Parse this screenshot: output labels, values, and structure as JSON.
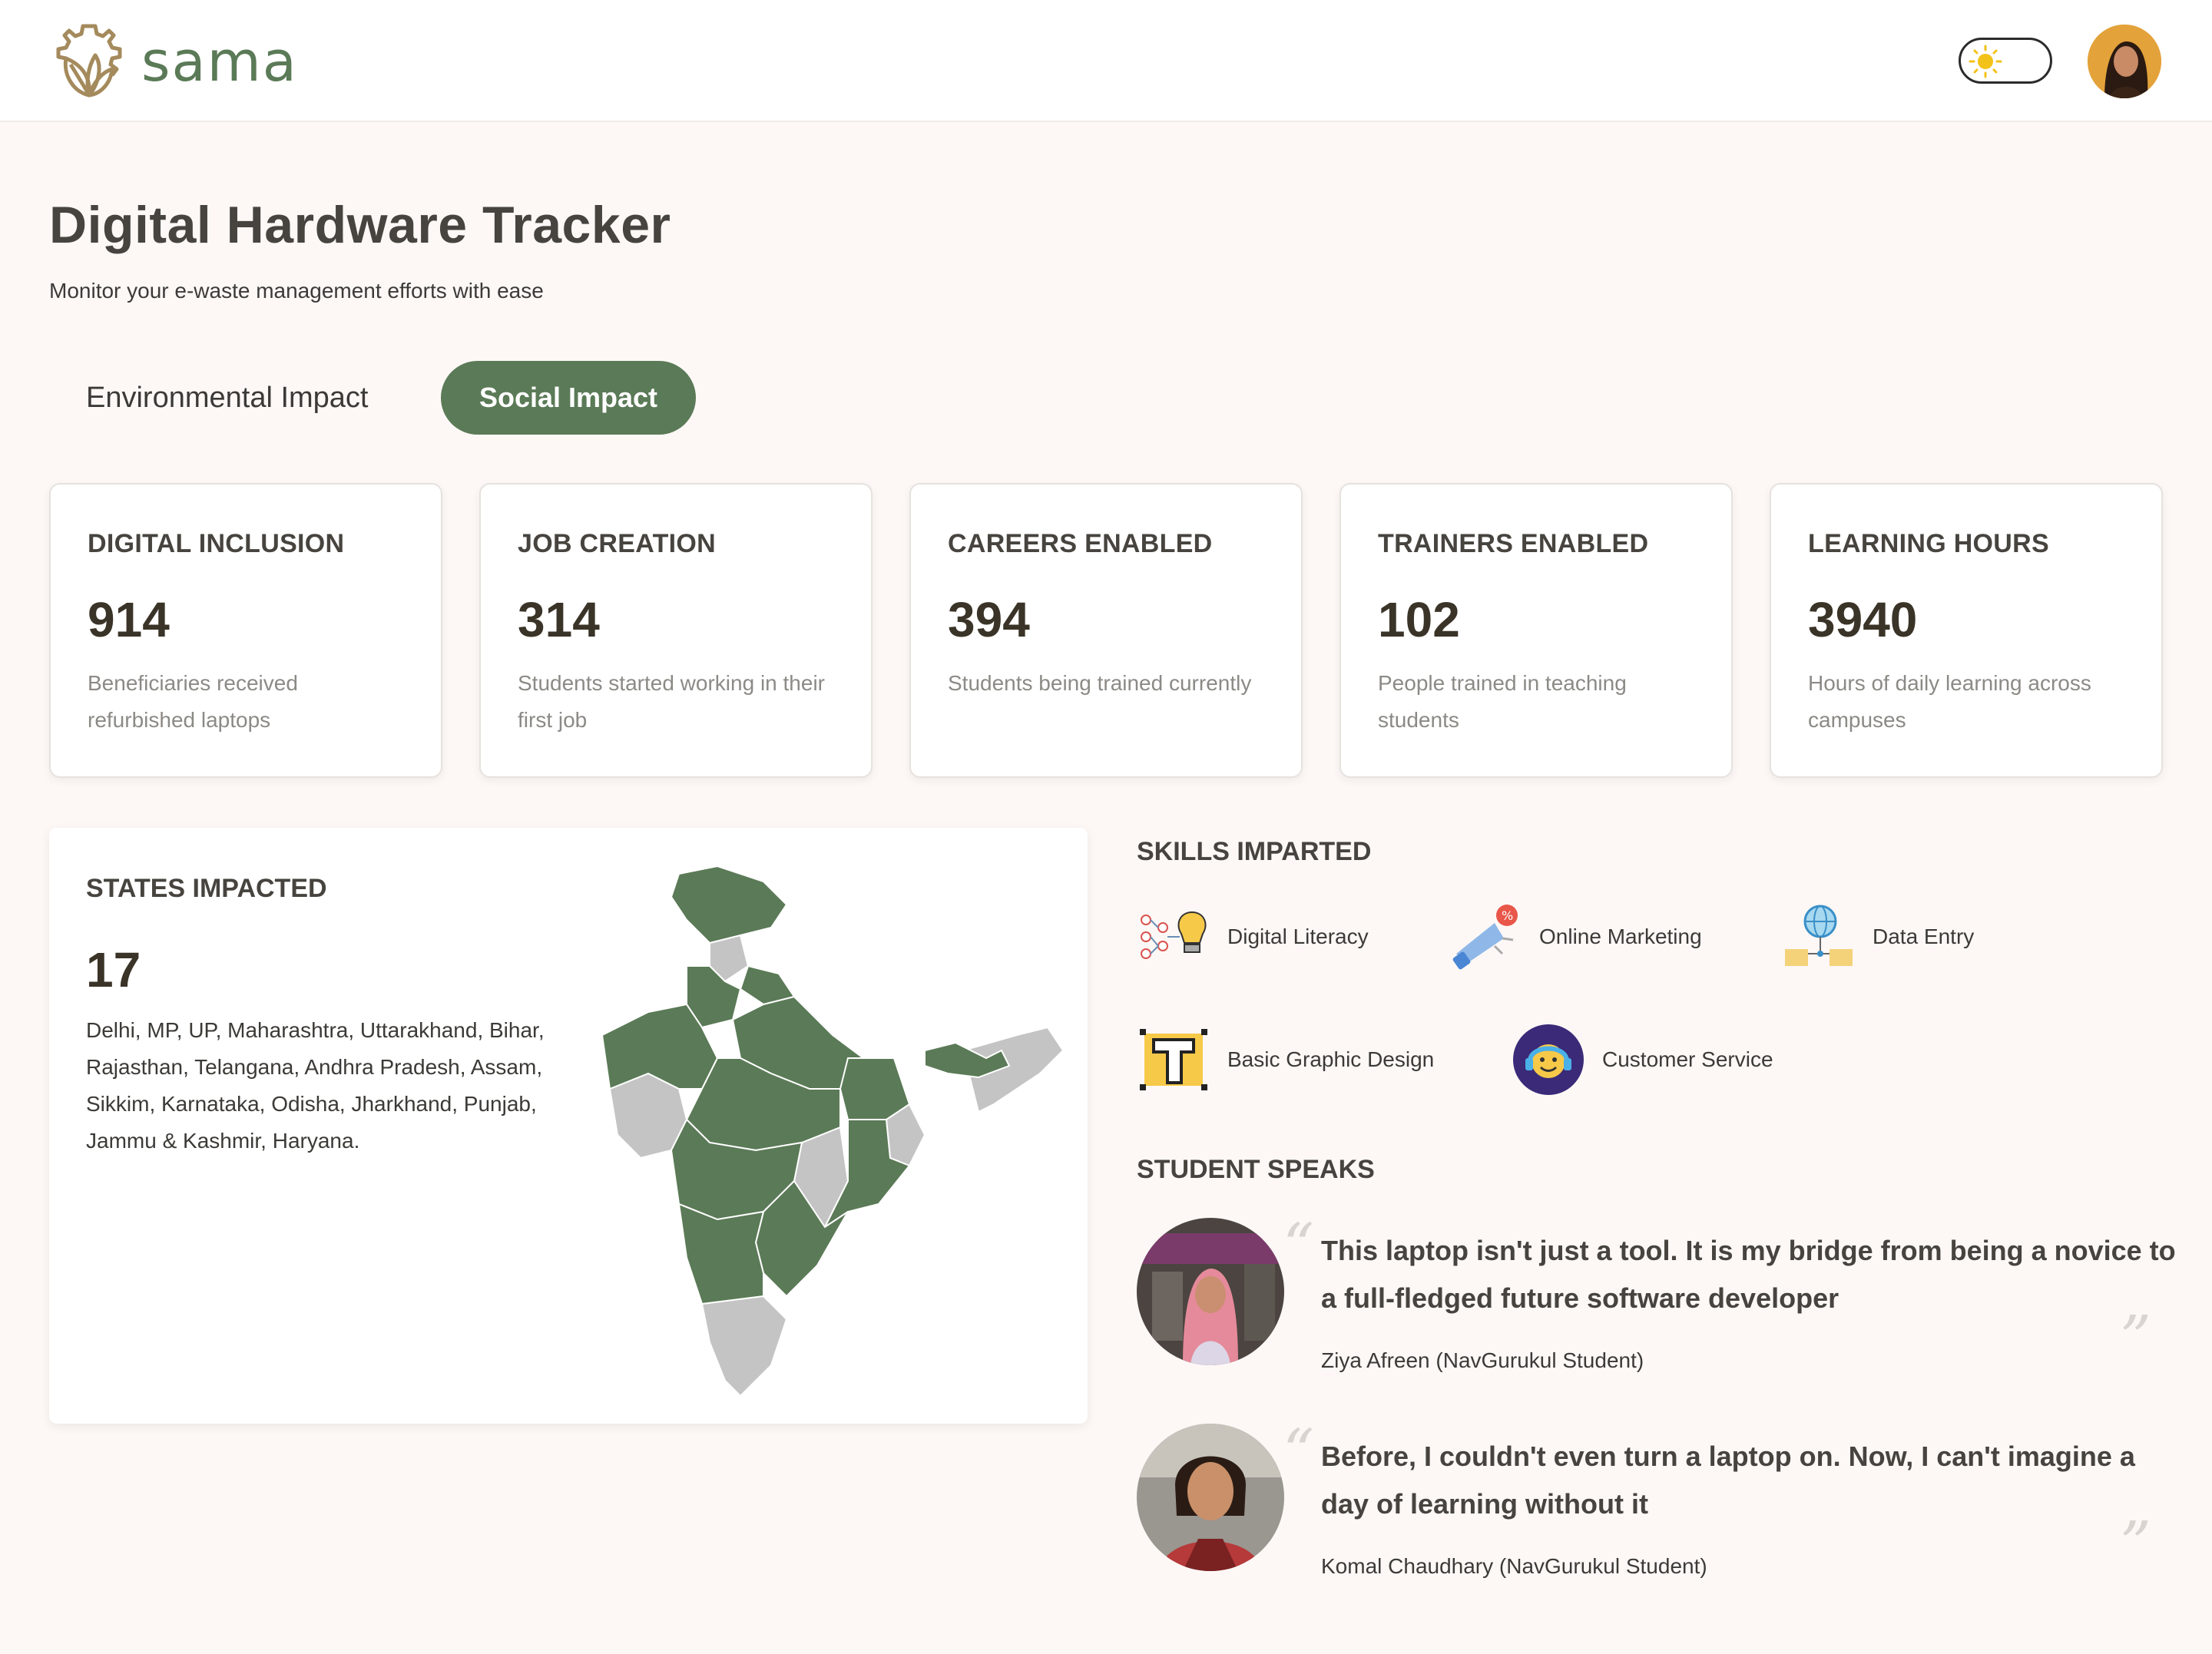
{
  "header": {
    "logo_text": "sama"
  },
  "page": {
    "title": "Digital Hardware Tracker",
    "subtitle": "Monitor your e-waste management efforts with ease"
  },
  "tabs": [
    {
      "label": "Environmental Impact",
      "active": false
    },
    {
      "label": "Social Impact",
      "active": true
    }
  ],
  "stats": [
    {
      "title": "DIGITAL INCLUSION",
      "value": "914",
      "desc": "Beneficiaries received refurbished laptops"
    },
    {
      "title": "JOB CREATION",
      "value": "314",
      "desc": "Students started working in their first job"
    },
    {
      "title": "CAREERS ENABLED",
      "value": "394",
      "desc": "Students being trained currently"
    },
    {
      "title": "TRAINERS ENABLED",
      "value": "102",
      "desc": "People trained in teaching students"
    },
    {
      "title": "LEARNING HOURS",
      "value": "3940",
      "desc": "Hours of daily learning across campuses"
    }
  ],
  "states": {
    "title": "STATES IMPACTED",
    "value": "17",
    "list": "Delhi, MP, UP, Maharashtra, Uttarakhand, Bihar, Rajasthan, Telangana, Andhra Pradesh, Assam, Sikkim, Karnataka, Odisha, Jharkhand, Punjab, Jammu & Kashmir, Haryana."
  },
  "skills": {
    "title": "SKILLS IMPARTED",
    "items": [
      {
        "label": "Digital Literacy",
        "icon": "lightbulb-network-icon"
      },
      {
        "label": "Online Marketing",
        "icon": "megaphone-icon"
      },
      {
        "label": "Data Entry",
        "icon": "globe-folders-icon"
      },
      {
        "label": "Basic Graphic Design",
        "icon": "type-tool-icon"
      },
      {
        "label": "Customer Service",
        "icon": "headset-icon"
      }
    ]
  },
  "testimonials": {
    "title": "STUDENT SPEAKS",
    "items": [
      {
        "quote": "This laptop isn't just a tool. It is my bridge from being a novice to a full-fledged future software developer",
        "author": "Ziya Afreen (NavGurukul Student)"
      },
      {
        "quote": "Before, I couldn't even turn a laptop on. Now, I can't imagine a day of learning without it",
        "author": "Komal Chaudhary (NavGurukul Student)"
      }
    ]
  },
  "colors": {
    "brand_green": "#5b7a57",
    "map_highlight": "#5b7a57",
    "map_other": "#c4c4c4",
    "background": "#fdf8f6"
  }
}
